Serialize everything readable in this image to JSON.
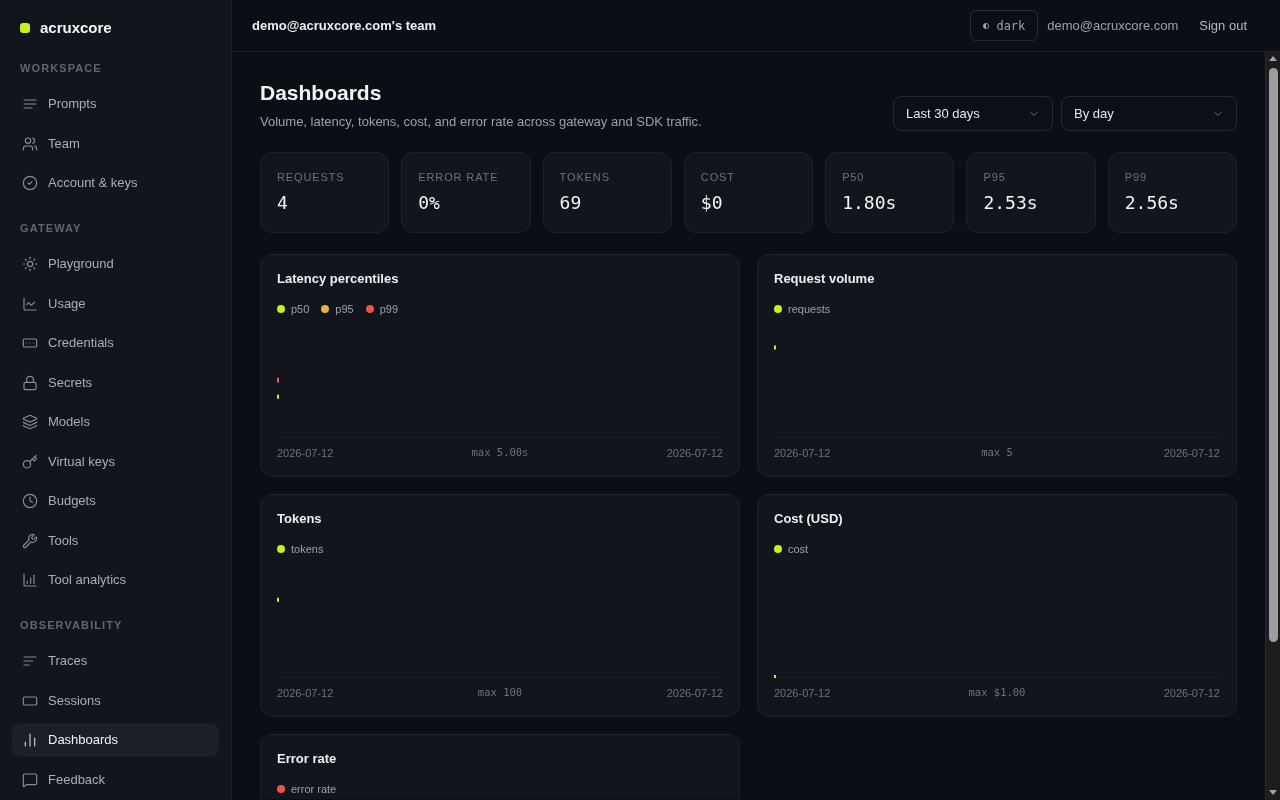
{
  "sidebar": {
    "brand": "acruxcore",
    "sections": [
      {
        "title": "WORKSPACE",
        "items": [
          {
            "label": "Prompts",
            "selected": false
          },
          {
            "label": "Team",
            "selected": false
          },
          {
            "label": "Account & keys",
            "selected": false
          }
        ]
      },
      {
        "title": "GATEWAY",
        "items": [
          {
            "label": "Playground",
            "selected": false
          },
          {
            "label": "Usage",
            "selected": false
          },
          {
            "label": "Credentials",
            "selected": false
          },
          {
            "label": "Secrets",
            "selected": false
          },
          {
            "label": "Models",
            "selected": false
          },
          {
            "label": "Virtual keys",
            "selected": false
          },
          {
            "label": "Budgets",
            "selected": false
          },
          {
            "label": "Tools",
            "selected": false
          },
          {
            "label": "Tool analytics",
            "selected": false
          }
        ]
      },
      {
        "title": "OBSERVABILITY",
        "items": [
          {
            "label": "Traces",
            "selected": false
          },
          {
            "label": "Sessions",
            "selected": false
          },
          {
            "label": "Dashboards",
            "selected": true
          },
          {
            "label": "Feedback",
            "selected": false
          }
        ]
      }
    ]
  },
  "topbar": {
    "team": "demo@acruxcore.com's team",
    "theme": "dark",
    "email": "demo@acruxcore.com",
    "sign_out": "Sign out"
  },
  "page": {
    "title": "Dashboards",
    "subtitle": "Volume, latency, tokens, cost, and error rate across gateway and SDK traffic.",
    "filters": [
      {
        "value": "Last 30 days"
      },
      {
        "value": "By day"
      }
    ]
  },
  "stats": [
    {
      "label": "REQUESTS",
      "value": "4"
    },
    {
      "label": "ERROR RATE",
      "value": "0%"
    },
    {
      "label": "TOKENS",
      "value": "69"
    },
    {
      "label": "COST",
      "value": "$0"
    },
    {
      "label": "P50",
      "value": "1.80s"
    },
    {
      "label": "P95",
      "value": "2.53s"
    },
    {
      "label": "P99",
      "value": "2.56s"
    }
  ],
  "charts": [
    {
      "title": "Latency percentiles",
      "legend": [
        {
          "name": "p50",
          "color": "#c6f11b"
        },
        {
          "name": "p95",
          "color": "#e3b04b"
        },
        {
          "name": "p99",
          "color": "#ef5442"
        }
      ],
      "x_start": "2026-07-12",
      "max_label": "max 5.00s",
      "x_end": "2026-07-12"
    },
    {
      "title": "Request volume",
      "legend": [
        {
          "name": "requests",
          "color": "#c6f11b"
        }
      ],
      "x_start": "2026-07-12",
      "max_label": "max 5",
      "x_end": "2026-07-12"
    },
    {
      "title": "Tokens",
      "legend": [
        {
          "name": "tokens",
          "color": "#c6f11b"
        }
      ],
      "x_start": "2026-07-12",
      "max_label": "max 100",
      "x_end": "2026-07-12"
    },
    {
      "title": "Cost (USD)",
      "legend": [
        {
          "name": "cost",
          "color": "#c6f11b"
        }
      ],
      "x_start": "2026-07-12",
      "max_label": "max $1.00",
      "x_end": "2026-07-12"
    },
    {
      "title": "Error rate",
      "legend": [
        {
          "name": "error rate",
          "color": "#ef5442"
        }
      ]
    }
  ]
}
